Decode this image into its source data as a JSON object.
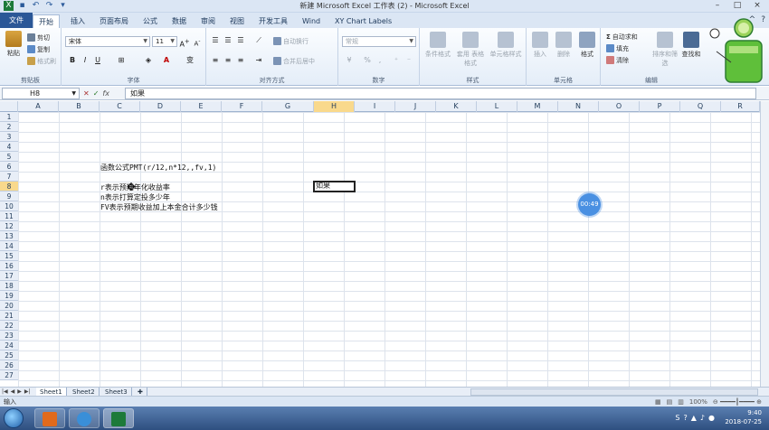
{
  "window": {
    "title": "新建 Microsoft Excel 工作表 (2) - Microsoft Excel"
  },
  "menu_tabs": [
    "文件",
    "开始",
    "插入",
    "页面布局",
    "公式",
    "数据",
    "审阅",
    "视图",
    "开发工具",
    "Wind",
    "XY Chart Labels"
  ],
  "ribbon": {
    "clipboard": {
      "paste": "粘贴",
      "cut": "剪切",
      "copy": "复制",
      "format_painter": "格式刷",
      "label": "剪贴板"
    },
    "font": {
      "name": "宋体",
      "size": "11",
      "bold": "B",
      "italic": "I",
      "underline": "U",
      "label": "字体"
    },
    "alignment": {
      "wrap": "自动换行",
      "merge": "合并后居中",
      "label": "对齐方式"
    },
    "number": {
      "format": "常规",
      "percent": "%",
      "comma": ",",
      "label": "数字"
    },
    "styles": {
      "conditional": "条件格式",
      "table": "套用\n表格格式",
      "cell_styles": "单元格样式",
      "label": "样式"
    },
    "cells": {
      "insert": "插入",
      "delete": "删除",
      "format": "格式",
      "label": "单元格"
    },
    "editing": {
      "autosum": "自动求和",
      "fill": "填充",
      "clear": "清除",
      "sort": "排序和筛选",
      "find": "查找和",
      "label": "编辑"
    }
  },
  "formula_bar": {
    "name_box": "H8",
    "content": "如果"
  },
  "columns": [
    "A",
    "B",
    "C",
    "D",
    "E",
    "F",
    "G",
    "H",
    "I",
    "J",
    "K",
    "L",
    "M",
    "N",
    "O",
    "P",
    "Q",
    "R"
  ],
  "rows": [
    "1",
    "2",
    "3",
    "4",
    "5",
    "6",
    "7",
    "8",
    "9",
    "10",
    "11",
    "12",
    "13",
    "14",
    "15",
    "16",
    "17",
    "18",
    "19",
    "20",
    "21",
    "22",
    "23",
    "24",
    "25",
    "26",
    "27"
  ],
  "cells": {
    "c6": "函数公式PMT(r/12,n*12,,fv,1)",
    "c8": "r表示预期年化收益率",
    "c9": "n表示打算定投多少年",
    "c10": "FV表示预期收益加上本金合计多少钱",
    "h8": "如果"
  },
  "timer_badge": "00:49",
  "sheets": [
    "Sheet1",
    "Sheet2",
    "Sheet3"
  ],
  "status": {
    "mode": "输入",
    "zoom": "100%"
  },
  "tray": {
    "time": "9:40",
    "date": "2018-07-25"
  },
  "colors": {
    "file_tab": "#2b5797",
    "selected_header": "#f9d98c",
    "badge": "#4a90e2"
  }
}
